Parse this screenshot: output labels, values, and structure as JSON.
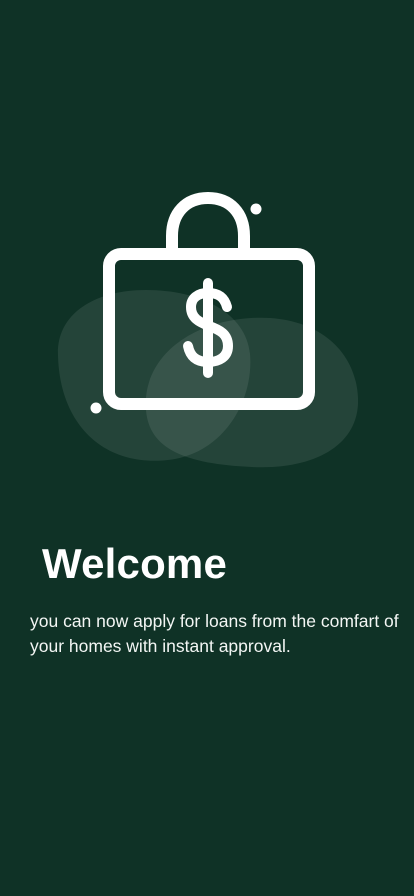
{
  "welcome": {
    "title": "Welcome",
    "description": "you can now apply for loans from the comfart of your homes with instant approval."
  },
  "illustration": {
    "icon": "money-bag-icon"
  },
  "colors": {
    "background": "#0f3226",
    "blob": "#2a4a40",
    "foreground": "#ffffff"
  }
}
